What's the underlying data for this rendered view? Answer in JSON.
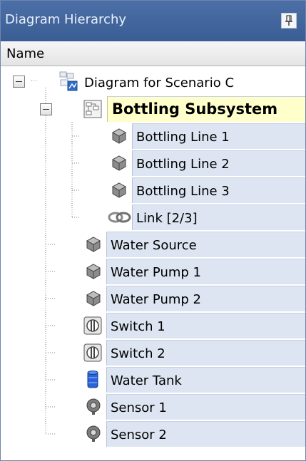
{
  "panel": {
    "title": "Diagram Hierarchy",
    "pin_icon": "pin-icon",
    "column_header": "Name"
  },
  "tree": {
    "root": {
      "label": "Diagram for Scenario C",
      "icon": "diagram-icon",
      "expanded": true
    },
    "subsystem": {
      "label": "Bottling Subsystem",
      "icon": "subsystem-icon",
      "expanded": true,
      "highlighted": true
    },
    "subsystem_children": [
      {
        "label": "Bottling Line 1",
        "icon": "cube-icon"
      },
      {
        "label": "Bottling Line 2",
        "icon": "cube-icon"
      },
      {
        "label": "Bottling Line 3",
        "icon": "cube-icon"
      },
      {
        "label": "Link [2/3]",
        "icon": "link-icon"
      }
    ],
    "root_children": [
      {
        "label": "Water Source",
        "icon": "cube-icon"
      },
      {
        "label": "Water Pump 1",
        "icon": "cube-icon"
      },
      {
        "label": "Water Pump 2",
        "icon": "cube-icon"
      },
      {
        "label": "Switch 1",
        "icon": "switch-icon"
      },
      {
        "label": "Switch 2",
        "icon": "switch-icon"
      },
      {
        "label": "Water Tank",
        "icon": "tank-icon"
      },
      {
        "label": "Sensor 1",
        "icon": "sensor-icon"
      },
      {
        "label": "Sensor 2",
        "icon": "sensor-icon"
      }
    ]
  },
  "colors": {
    "title_bar": "#3f6199",
    "cell_background": "#dce5f1",
    "highlight": "#ffffcc"
  }
}
